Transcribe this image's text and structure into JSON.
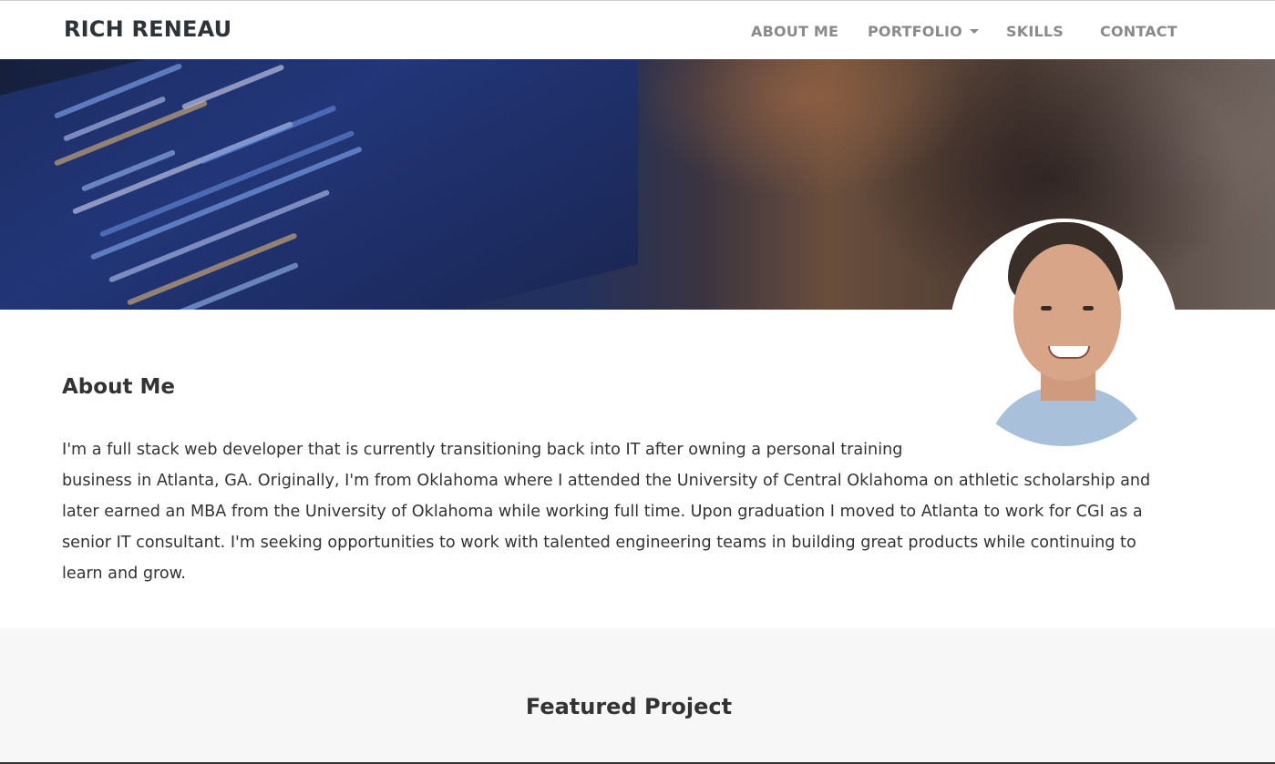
{
  "navbar": {
    "brand": "RICH RENEAU",
    "links": [
      {
        "label": "ABOUT ME"
      },
      {
        "label": "PORTFOLIO"
      },
      {
        "label": "SKILLS"
      },
      {
        "label": "CONTACT"
      }
    ]
  },
  "hero": {
    "image": "code-on-laptop-screen-photo"
  },
  "avatar": {
    "image": "profile-photo-smiling-man"
  },
  "about": {
    "title": "About Me",
    "line1": "I'm a full stack web developer that is currently transitioning back into IT after owning a personal training",
    "rest": "business in Atlanta, GA.  Originally, I'm from Oklahoma where I attended the University of Central Oklahoma on athletic scholarship and later earned an MBA from the University of Oklahoma while working full time.  Upon graduation I moved to Atlanta to work for CGI as a senior IT consultant.  I'm seeking opportunities to work with talented engineering teams in building great products while continuing to learn and grow."
  },
  "featured": {
    "title": "Featured Project"
  },
  "colors": {
    "nav_text": "#8a8a8a",
    "brand_text": "#2e3338",
    "featured_bg": "#f7f7f7"
  }
}
